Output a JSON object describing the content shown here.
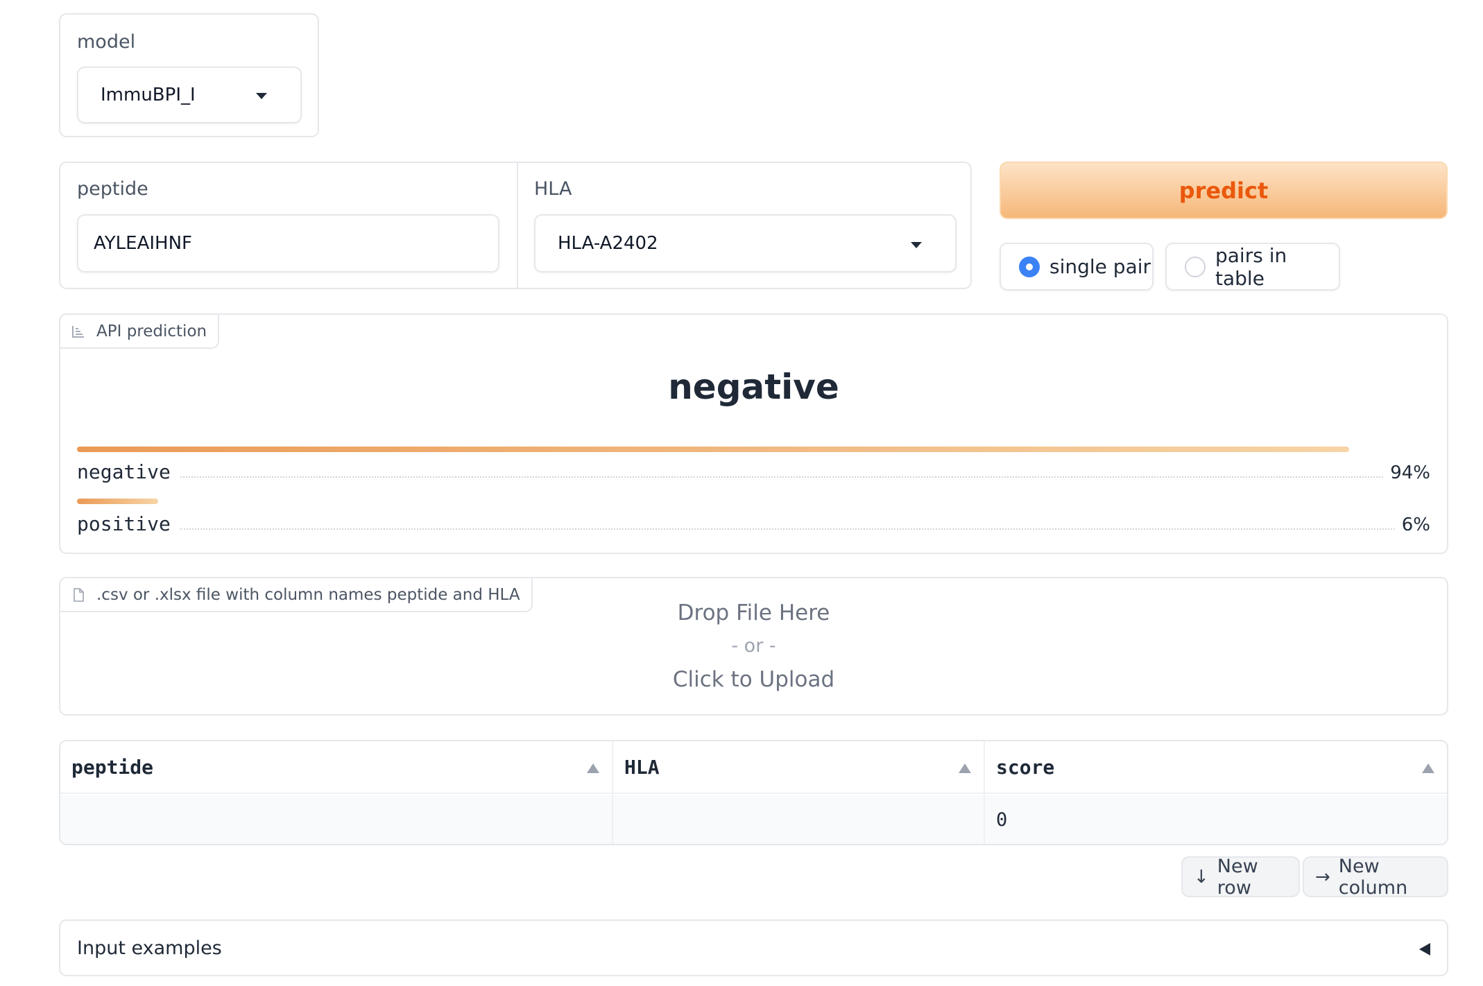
{
  "model": {
    "label": "model",
    "selected": "ImmuBPI_I"
  },
  "peptide": {
    "label": "peptide",
    "value": "AYLEAIHNF"
  },
  "hla": {
    "label": "HLA",
    "selected": "HLA-A2402"
  },
  "predict": {
    "label": "predict"
  },
  "mode": {
    "options": [
      "single pair",
      "pairs in table"
    ],
    "selected": "single pair"
  },
  "prediction": {
    "tag": "API prediction",
    "top_label": "negative",
    "confidences": [
      {
        "label": "negative",
        "percent_text": "94%",
        "value": 0.94
      },
      {
        "label": "positive",
        "percent_text": "6%",
        "value": 0.06
      }
    ]
  },
  "upload": {
    "tag": ".csv or .xlsx file with column names peptide and HLA",
    "line1": "Drop File Here",
    "line2": "- or -",
    "line3": "Click to Upload"
  },
  "table": {
    "headers": [
      "peptide",
      "HLA",
      "score"
    ],
    "rows": [
      [
        "",
        "",
        "0"
      ]
    ]
  },
  "buttons": {
    "new_row": "New row",
    "new_column": "New column"
  },
  "examples": {
    "title": "Input examples"
  },
  "colors": {
    "accent": "#ea580c",
    "radio": "#3b82f6",
    "bar_start": "#ea9a55",
    "bar_end": "#f7d4a6"
  }
}
